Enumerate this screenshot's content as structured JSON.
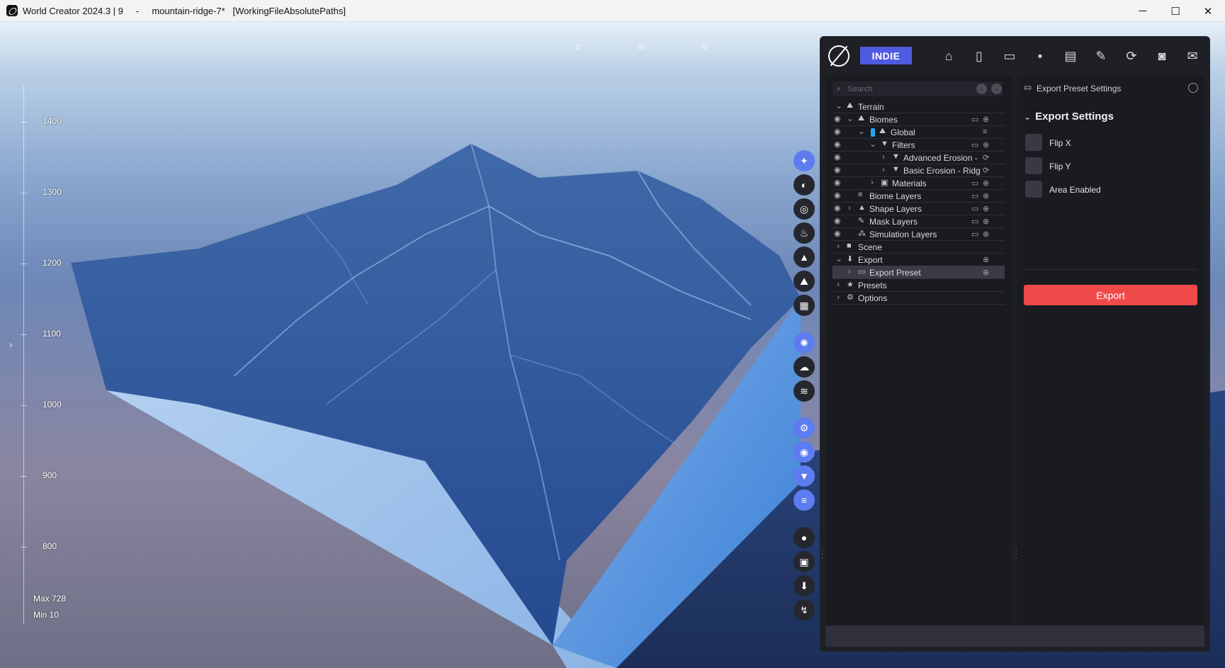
{
  "window": {
    "title": "World Creator 2024.3 | 9     -     mountain-ridge-7*   [WorkingFileAbsolutePaths]",
    "minimize": "─",
    "maximize": "☐",
    "close": "✕"
  },
  "viewport": {
    "compass": [
      "S",
      "W",
      "N"
    ],
    "ruler_labels": [
      "1400",
      "1300",
      "1200",
      "1100",
      "1000",
      "900",
      "800"
    ],
    "max_label": "Max 728",
    "min_label": "Min 10",
    "left_arrow": "›"
  },
  "toolstrip": {
    "icons": [
      "compass-icon",
      "globe-icon",
      "sky-icon",
      "fire-icon",
      "mountain-icon",
      "landscape-icon",
      "grid-icon",
      "settings-icon",
      "clouds-icon",
      "water-icon",
      "gear-tools-icon",
      "eye-icon",
      "filter-icon",
      "layers-icon",
      "record-icon",
      "image-icon",
      "download-icon",
      "stats-icon"
    ]
  },
  "panel": {
    "badge": "INDIE",
    "top_buttons": [
      "home-icon",
      "new-file-icon",
      "open-folder-icon",
      "save-icon",
      "save-as-icon",
      "edit-icon",
      "refresh-icon",
      "camera-icon",
      "chat-icon"
    ],
    "search_placeholder": "Search",
    "tree": [
      {
        "label": "Terrain",
        "indent": 0,
        "chevron": "v",
        "eye": false,
        "icon": "terrain-icon",
        "actions": []
      },
      {
        "label": "Biomes",
        "indent": 1,
        "chevron": "v",
        "eye": true,
        "icon": "biome-icon",
        "actions": [
          "folder",
          "add"
        ]
      },
      {
        "label": "Global",
        "indent": 2,
        "chevron": "v",
        "eye": true,
        "icon": "global-icon",
        "chip": true,
        "actions": [
          "layers"
        ]
      },
      {
        "label": "Filters",
        "indent": 3,
        "chevron": "v",
        "eye": true,
        "icon": "filter-icon",
        "actions": [
          "folder",
          "add"
        ]
      },
      {
        "label": "Advanced Erosion - Se",
        "indent": 4,
        "chevron": ">",
        "eye": true,
        "icon": "filter-icon",
        "actions": [
          "sync"
        ]
      },
      {
        "label": "Basic Erosion - Ridged",
        "indent": 4,
        "chevron": ">",
        "eye": true,
        "icon": "filter-icon",
        "actions": [
          "sync"
        ]
      },
      {
        "label": "Materials",
        "indent": 3,
        "chevron": ">",
        "eye": true,
        "icon": "materials-icon",
        "actions": [
          "folder",
          "add"
        ]
      },
      {
        "label": "Biome Layers",
        "indent": 1,
        "chevron": "",
        "eye": true,
        "icon": "layers-icon",
        "actions": [
          "folder",
          "add"
        ]
      },
      {
        "label": "Shape Layers",
        "indent": 1,
        "chevron": ">",
        "eye": true,
        "icon": "shape-icon",
        "actions": [
          "folder",
          "add"
        ]
      },
      {
        "label": "Mask Layers",
        "indent": 1,
        "chevron": "",
        "eye": true,
        "icon": "brush-icon",
        "actions": [
          "folder",
          "add"
        ]
      },
      {
        "label": "Simulation Layers",
        "indent": 1,
        "chevron": "",
        "eye": true,
        "icon": "simulation-icon",
        "actions": [
          "folder",
          "add"
        ]
      },
      {
        "label": "Scene",
        "indent": 0,
        "chevron": ">",
        "eye": false,
        "icon": "camera-icon",
        "actions": []
      },
      {
        "label": "Export",
        "indent": 0,
        "chevron": "v",
        "eye": false,
        "icon": "export-icon",
        "actions": [
          "add"
        ]
      },
      {
        "label": "Export Preset",
        "indent": 1,
        "chevron": ">",
        "eye": false,
        "icon": "folder-icon",
        "actions": [
          "add"
        ],
        "selected": true
      },
      {
        "label": "Presets",
        "indent": 0,
        "chevron": ">",
        "eye": false,
        "icon": "star-icon",
        "actions": []
      },
      {
        "label": "Options",
        "indent": 0,
        "chevron": ">",
        "eye": false,
        "icon": "gear-icon",
        "actions": []
      }
    ],
    "settings": {
      "header": "Export Preset Settings",
      "section_title": "Export Settings",
      "checkboxes": [
        "Flip X",
        "Flip Y",
        "Area Enabled"
      ],
      "export_button": "Export"
    }
  }
}
